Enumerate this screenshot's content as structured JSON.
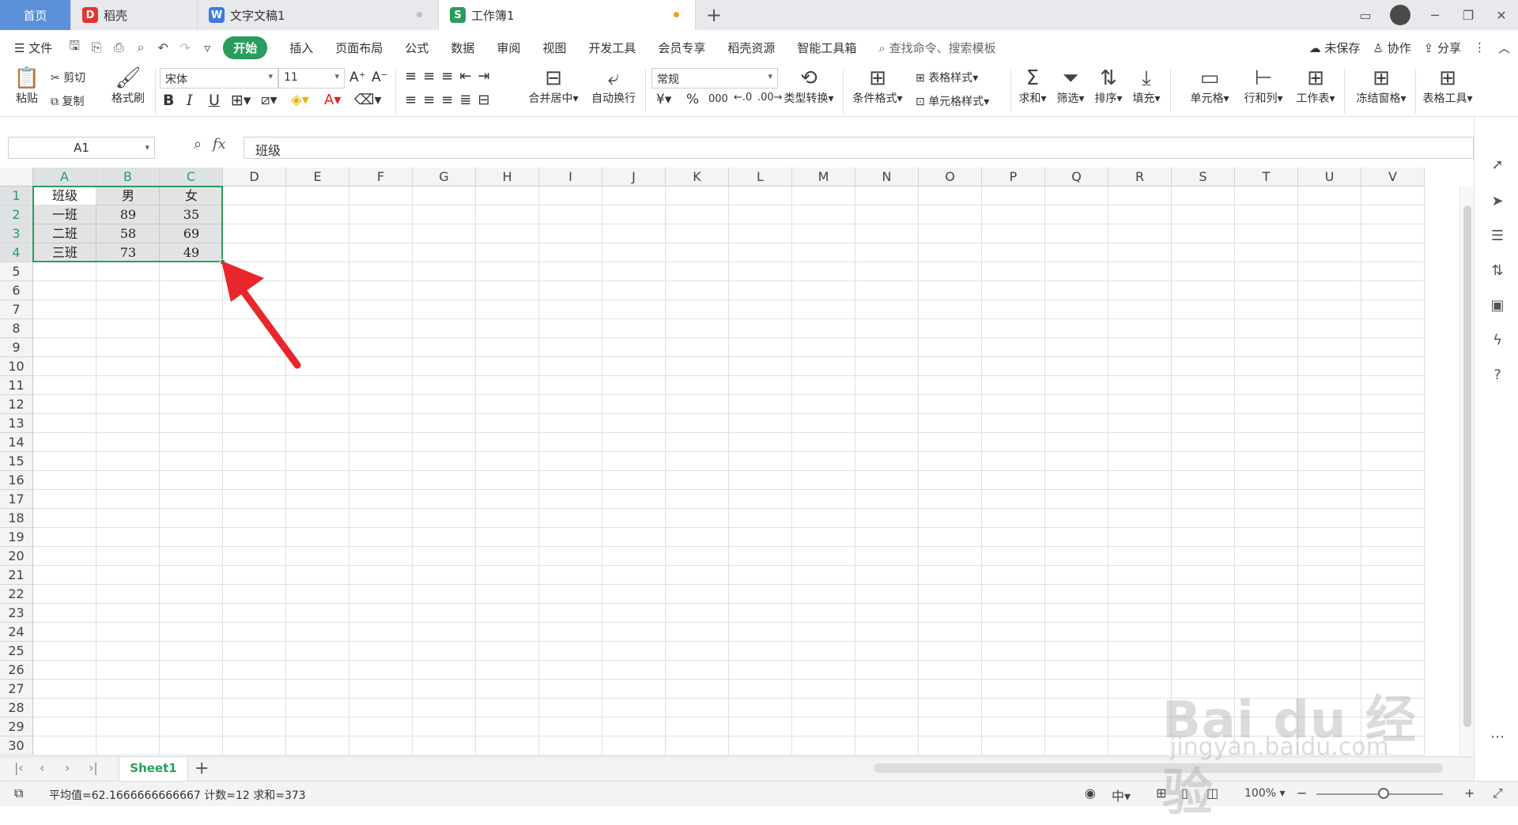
{
  "tabs": [
    {
      "label": "首页"
    },
    {
      "label": "稻壳"
    },
    {
      "label": "文字文稿1"
    },
    {
      "label": "工作簿1"
    }
  ],
  "menu": {
    "file": "文件",
    "start": "开始",
    "items": [
      "插入",
      "页面布局",
      "公式",
      "数据",
      "审阅",
      "视图",
      "开发工具",
      "会员专享",
      "稻壳资源",
      "智能工具箱"
    ],
    "search": "查找命令、搜索模板",
    "unsaved": "未保存",
    "collab": "协作",
    "share": "分享"
  },
  "ribbon": {
    "paste": "粘贴",
    "cut": "剪切",
    "copy": "复制",
    "format_painter": "格式刷",
    "font": "宋体",
    "font_size": "11",
    "bold": "B",
    "italic": "I",
    "underline": "U",
    "merge_center": "合并居中",
    "wrap": "自动换行",
    "number_format": "常规",
    "percent": "%",
    "thousands": "000",
    "type_convert": "类型转换",
    "cond_format": "条件格式",
    "table_style": "表格样式",
    "cell_style": "单元格样式",
    "sum": "求和",
    "filter": "筛选",
    "sort": "排序",
    "fill": "填充",
    "cell": "单元格",
    "row_col": "行和列",
    "worksheet": "工作表",
    "freeze": "冻结窗格",
    "table_tools": "表格工具"
  },
  "formula_bar": {
    "cell_ref": "A1",
    "fx": "fx",
    "content": "班级"
  },
  "grid": {
    "columns": [
      "A",
      "B",
      "C",
      "D",
      "E",
      "F",
      "G",
      "H",
      "I",
      "J",
      "K",
      "L",
      "M",
      "N",
      "O",
      "P",
      "Q",
      "R",
      "S",
      "T",
      "U",
      "V"
    ],
    "rows": [
      "1",
      "2",
      "3",
      "4",
      "5",
      "6",
      "7",
      "8",
      "9",
      "10",
      "11",
      "12",
      "13",
      "14",
      "15",
      "16",
      "17",
      "18",
      "19",
      "20",
      "21",
      "22",
      "23",
      "24",
      "25",
      "26",
      "27",
      "28",
      "29",
      "30"
    ],
    "data": [
      [
        "班级",
        "男",
        "女"
      ],
      [
        "一班",
        "89",
        "35"
      ],
      [
        "二班",
        "58",
        "69"
      ],
      [
        "三班",
        "73",
        "49"
      ]
    ]
  },
  "sheet_tabs": [
    "Sheet1"
  ],
  "status": {
    "summary": "平均值=62.1666666666667  计数=12  求和=373",
    "zoom": "100%"
  },
  "colors": {
    "accent": "#2a9d5d",
    "home_tab": "#5b8fd9",
    "annotation": "#e8262b"
  },
  "watermark": {
    "brand": "Bai du 经验",
    "url": "jingyan.baidu.com"
  }
}
